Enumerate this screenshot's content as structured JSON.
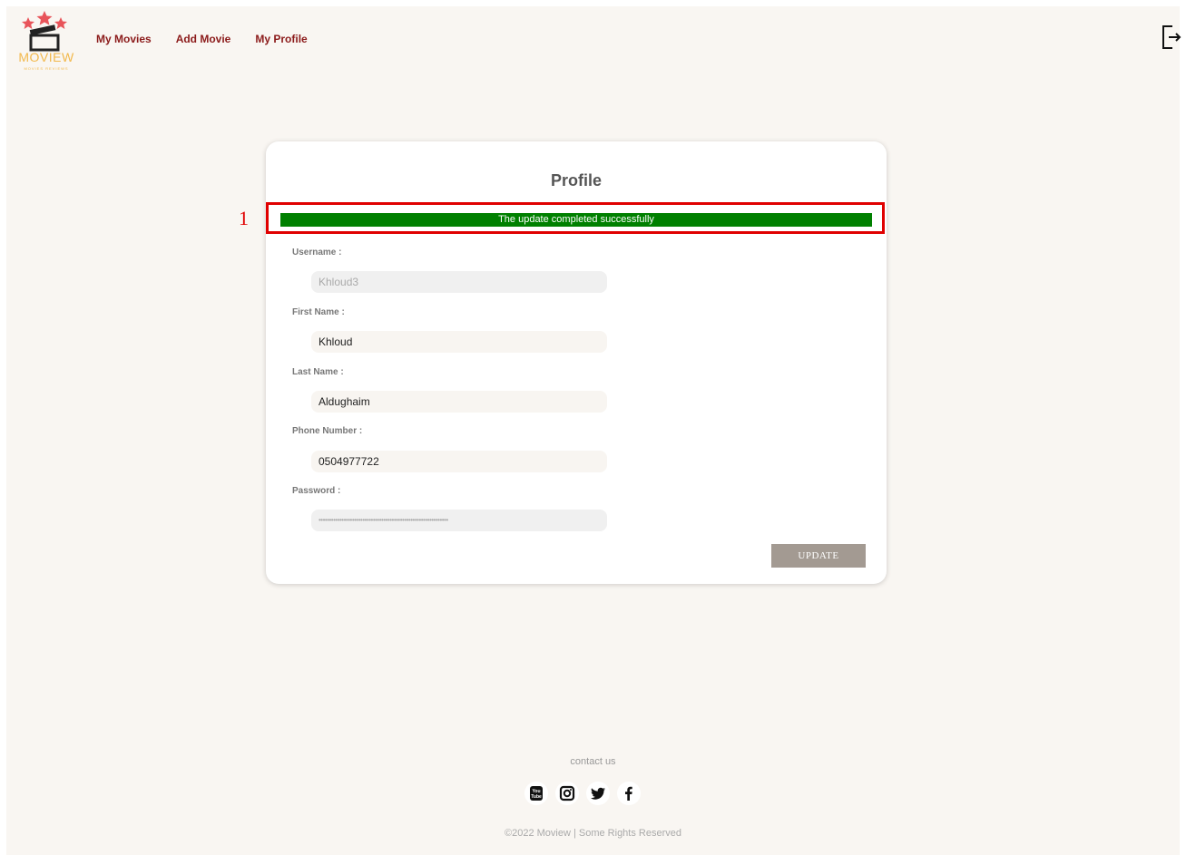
{
  "brand": {
    "name": "MOVIEW",
    "tagline": "MOVIES REVIEWS",
    "accent": "#8b1a1a",
    "logo_gold": "#f2b84b"
  },
  "nav": {
    "items": [
      {
        "label": "My Movies"
      },
      {
        "label": "Add Movie"
      },
      {
        "label": "My Profile"
      }
    ],
    "logout_icon": "logout-icon"
  },
  "profile": {
    "title": "Profile",
    "annotation_number": "1",
    "success_message": "The update completed successfully",
    "success_color": "#008000",
    "fields": {
      "username": {
        "label": "Username :",
        "value": "Khloud3",
        "disabled": true
      },
      "first_name": {
        "label": "First Name :",
        "value": "Khloud"
      },
      "last_name": {
        "label": "Last Name :",
        "value": "Aldughaim"
      },
      "phone": {
        "label": "Phone Number :",
        "value": "0504977722"
      },
      "password": {
        "label": "Password :",
        "value": "••••••••••••••••••••••••••••••••••••••••••••••••••••••••••••••",
        "disabled": true
      }
    },
    "update_label": "UPDATE"
  },
  "footer": {
    "contact": "contact us",
    "socials": [
      "youtube-icon",
      "instagram-icon",
      "twitter-icon",
      "facebook-icon"
    ],
    "copyright": "©2022 Moview | Some Rights Reserved"
  }
}
